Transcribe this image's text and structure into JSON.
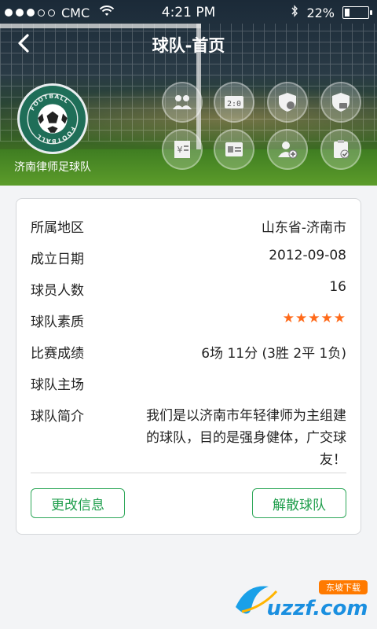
{
  "status_bar": {
    "carrier": "CMC",
    "time": "4:21 PM",
    "battery": "22%",
    "battery_level": 0.22,
    "signal_dots_filled": 3,
    "signal_dots_total": 5
  },
  "nav": {
    "title": "球队-首页"
  },
  "team": {
    "name": "济南律师足球队",
    "logo_text_top": "FOOTBALL",
    "logo_text_bottom": "FOOTBALL"
  },
  "hero_icons": [
    "members-icon",
    "scoreboard-icon",
    "shield-home-icon",
    "shield-stats-icon",
    "finance-icon",
    "roster-card-icon",
    "add-player-icon",
    "task-check-icon"
  ],
  "info": {
    "region": {
      "label": "所属地区",
      "value": "山东省-济南市"
    },
    "founded": {
      "label": "成立日期",
      "value": "2012-09-08"
    },
    "players": {
      "label": "球员人数",
      "value": "16"
    },
    "quality": {
      "label": "球队素质",
      "stars": "★★★★★",
      "rating": 5
    },
    "record": {
      "label": "比赛成绩",
      "value": "6场 11分 (3胜 2平 1负)"
    },
    "home": {
      "label": "球队主场",
      "value": ""
    },
    "intro": {
      "label": "球队简介",
      "value": "我们是以济南市年轻律师为主组建的球队，目的是强身健体，广交球友！"
    }
  },
  "actions": {
    "edit": "更改信息",
    "disband": "解散球队"
  },
  "watermark": {
    "cn": "东坡下载",
    "en": "uzzf.com"
  },
  "colors": {
    "accent_green": "#1f9e4c",
    "star_orange": "#ff6a1a"
  }
}
